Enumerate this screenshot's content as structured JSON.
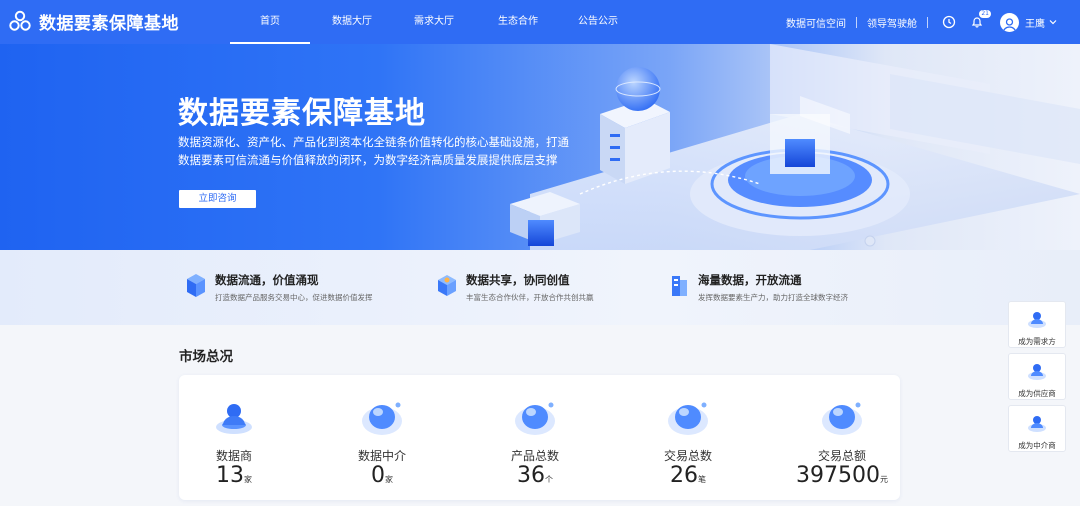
{
  "header": {
    "logo_text": "数据要素保障基地",
    "nav": [
      "首页",
      "数据大厅",
      "需求大厅",
      "生态合作",
      "公告公示"
    ],
    "right_links": [
      "数据可信空间",
      "领导驾驶舱"
    ],
    "notification_count": "21",
    "user_name": "王鹰"
  },
  "banner": {
    "title": "数据要素保障基地",
    "description": "数据资源化、资产化、产品化到资本化全链条价值转化的核心基础设施，打通数据要素可信流通与价值释放的闭环，为数字经济高质量发展提供底层支撑",
    "button": "立即咨询"
  },
  "features": [
    {
      "title": "数据流通，价值涌现",
      "desc": "打造数据产品服务交易中心，促进数据价值发挥"
    },
    {
      "title": "数据共享，协同创值",
      "desc": "丰富生态合作伙伴，开放合作共创共赢"
    },
    {
      "title": "海量数据，开放流通",
      "desc": "发挥数据要素生产力，助力打造全球数字经济"
    }
  ],
  "market": {
    "title": "市场总况",
    "stats": [
      {
        "label": "数据商",
        "value": "13",
        "unit": "家"
      },
      {
        "label": "数据中介",
        "value": "0",
        "unit": "家"
      },
      {
        "label": "产品总数",
        "value": "36",
        "unit": "个"
      },
      {
        "label": "交易总数",
        "value": "26",
        "unit": "笔"
      },
      {
        "label": "交易总额",
        "value": "397500",
        "unit": "元"
      }
    ]
  },
  "side_actions": [
    "成为需求方",
    "成为供应商",
    "成为中介商"
  ],
  "colors": {
    "primary": "#2f6cf4",
    "accent_light": "#5aa8ff"
  }
}
